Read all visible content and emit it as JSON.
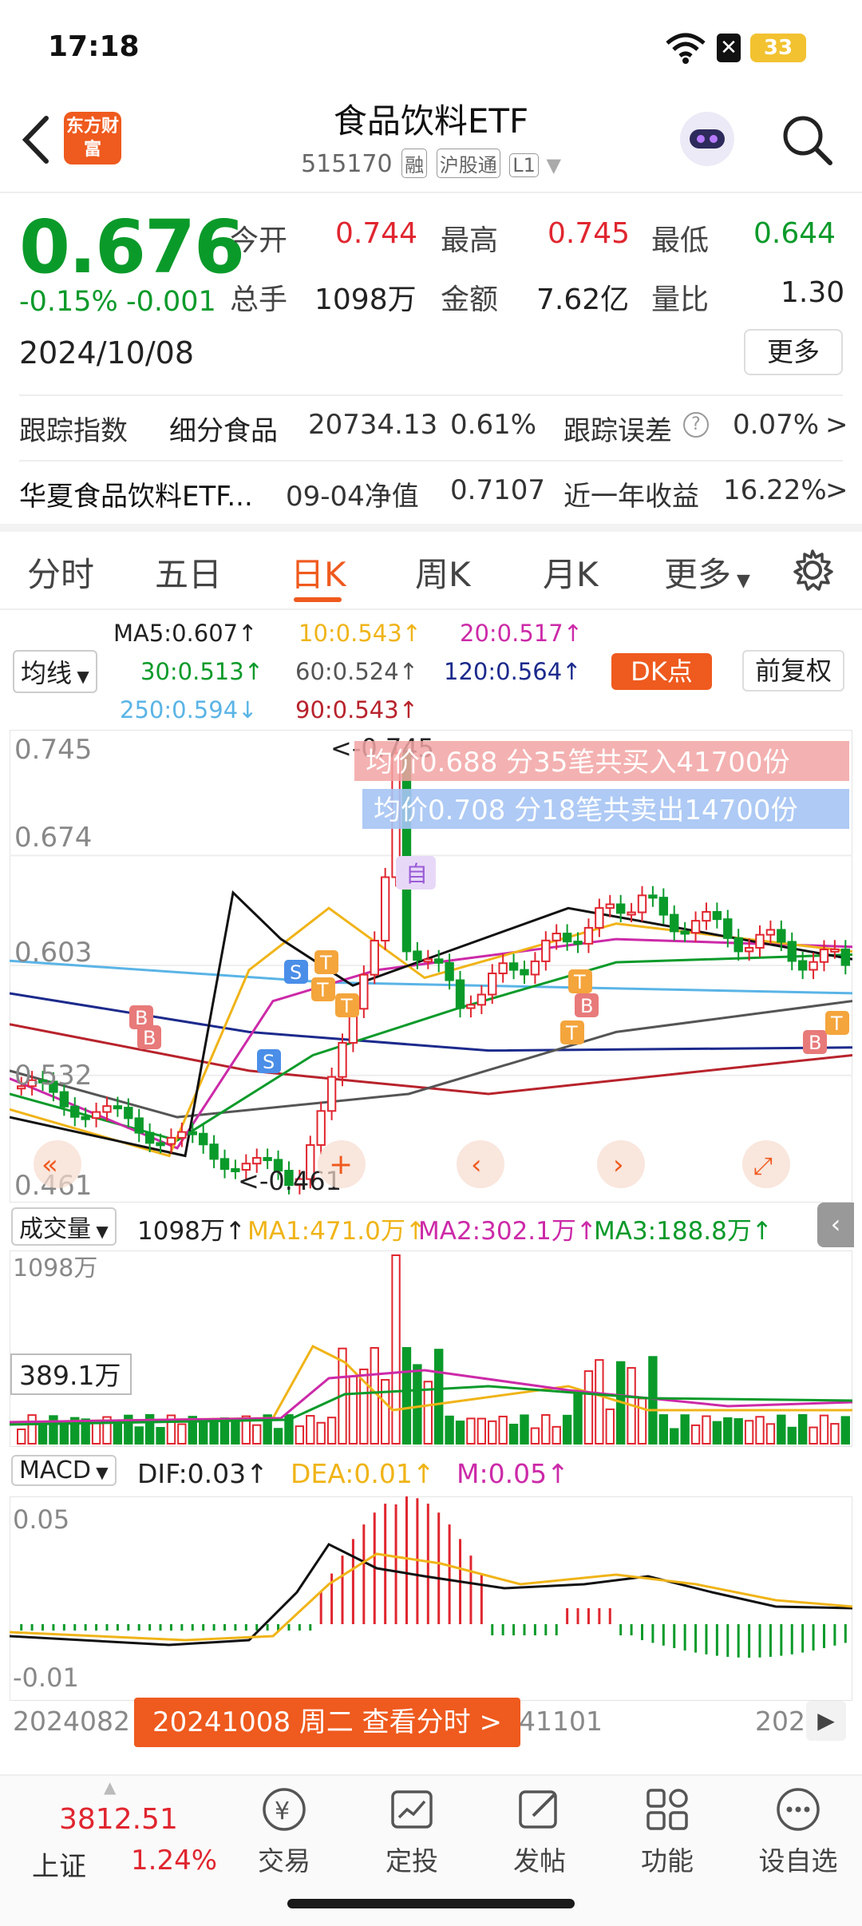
{
  "status": {
    "time": "17:18",
    "battery": "33"
  },
  "header": {
    "logo": "东方财富",
    "title": "食品饮料ETF",
    "code": "515170",
    "tags": [
      "融",
      "沪股通",
      "L1"
    ]
  },
  "quote": {
    "price": "0.676",
    "change_pct": "-0.15%",
    "change": "-0.001",
    "date": "2024/10/08",
    "open_label": "今开",
    "open": "0.744",
    "high_label": "最高",
    "high": "0.745",
    "low_label": "最低",
    "low": "0.644",
    "vol_label": "总手",
    "vol": "1098万",
    "amt_label": "金额",
    "amt": "7.62亿",
    "ratio_label": "量比",
    "ratio": "1.30",
    "more": "更多"
  },
  "track": {
    "label": "跟踪指数",
    "index": "细分食品",
    "value": "20734.13",
    "pct": "0.61%",
    "err_label": "跟踪误差",
    "err": "0.07%"
  },
  "fund": {
    "name": "华夏食品饮料ETF...",
    "nav_label": "09-04净值",
    "nav": "0.7107",
    "ret_label": "近一年收益",
    "ret": "16.22%"
  },
  "tabs": [
    "分时",
    "五日",
    "日K",
    "周K",
    "月K",
    "更多"
  ],
  "ma_legend": {
    "chip": "均线",
    "ma5": "MA5:0.607↑",
    "ma10": "10:0.543↑",
    "ma20": "20:0.517↑",
    "ma30": "30:0.513↑",
    "ma60": "60:0.524↑",
    "ma120": "120:0.564↑",
    "ma250": "250:0.594↓",
    "ma90": "90:0.543↑",
    "dk": "DK点",
    "fq": "前复权"
  },
  "kline": {
    "y_labels": [
      "0.745",
      "0.674",
      "0.603",
      "0.532",
      "0.461"
    ],
    "high_mark": "<-0.745",
    "low_mark": "<-0.461",
    "buy_note": "均价0.688  分35笔共买入41700份",
    "sell_note": "均价0.708  分18笔共卖出14700份",
    "zi": "自"
  },
  "volume": {
    "chip": "成交量",
    "text": "1098万↑",
    "ma1": "MA1:471.0万↑",
    "ma2": "MA2:302.1万↑",
    "ma3": "MA3:188.8万↑",
    "top": "1098万",
    "mid": "389.1万"
  },
  "macd": {
    "chip": "MACD",
    "dif": "DIF:0.03↑",
    "dea": "DEA:0.01↑",
    "m": "M:0.05↑",
    "top": "0.05",
    "bottom": "-0.01"
  },
  "xaxis": {
    "left": "2024082",
    "mid": "41101",
    "right": "202"
  },
  "tip": "20241008 周二 查看分时 >",
  "bottom": {
    "index_value": "3812.51",
    "index_name": "上证",
    "index_pct": "1.24%",
    "items": [
      "交易",
      "定投",
      "发帖",
      "功能",
      "设自选"
    ]
  },
  "colors": {
    "up": "#e0262f",
    "down": "#0a9a2a",
    "accent": "#ef5a1e"
  }
}
